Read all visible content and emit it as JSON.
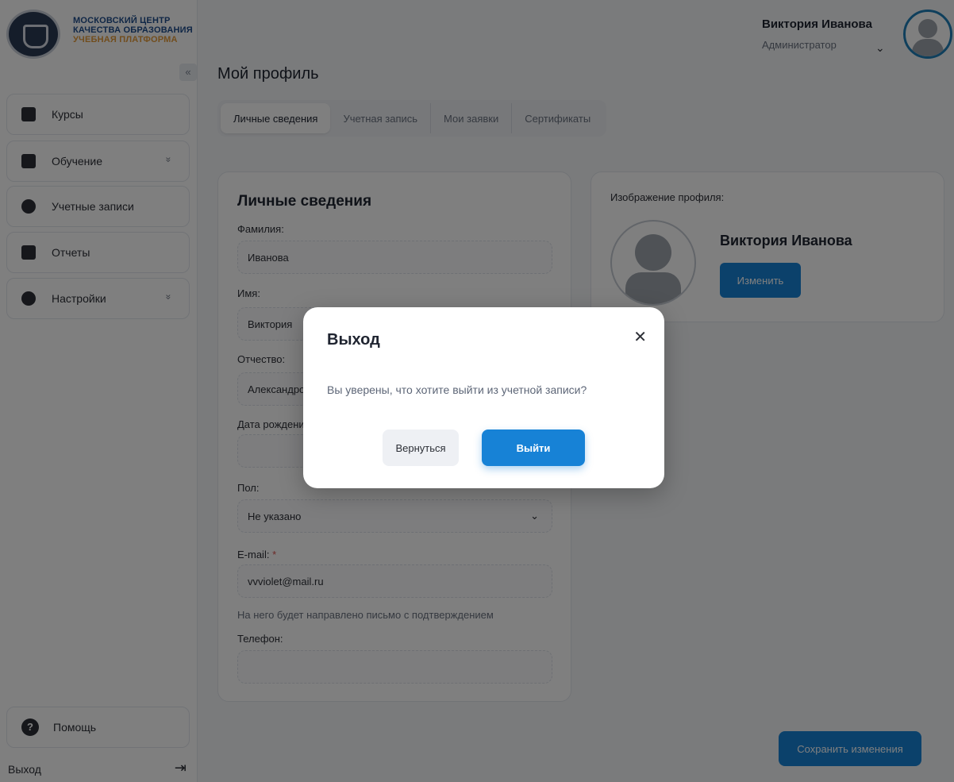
{
  "brand": {
    "line1": "МОСКОВСКИЙ ЦЕНТР",
    "line2": "КАЧЕСТВА ОБРАЗОВАНИЯ",
    "line3": "УЧЕБНАЯ ПЛАТФОРМА",
    "accent": "#1f4d8c",
    "accent2": "#e39a3a"
  },
  "sidebar": {
    "collapse_symbol": "«",
    "items": [
      {
        "label": "Курсы",
        "icon": "edit-icon"
      },
      {
        "label": "Обучение",
        "icon": "graduation-cap-icon",
        "chevron": "»"
      },
      {
        "label": "Учетные записи",
        "icon": "users-icon"
      },
      {
        "label": "Отчеты",
        "icon": "chart-icon"
      },
      {
        "label": "Настройки",
        "icon": "gear-icon",
        "chevron": "»"
      }
    ],
    "help_label": "Помощь",
    "help_symbol": "?",
    "logout_label": "Выход",
    "logout_symbol": "⇥"
  },
  "header": {
    "user_name": "Виктория Иванова",
    "user_role": "Администратор",
    "chevron": "⌄"
  },
  "page": {
    "title": "Мой профиль",
    "tabs": [
      {
        "label": "Личные сведения",
        "active": true
      },
      {
        "label": "Учетная запись"
      },
      {
        "label": "Мои заявки"
      },
      {
        "label": "Сертификаты"
      }
    ]
  },
  "personal": {
    "title": "Личные сведения",
    "last_name_label": "Фамилия:",
    "last_name": "Иванова",
    "first_name_label": "Имя:",
    "first_name": "Виктория",
    "middle_name_label": "Отчество:",
    "middle_name": "Александровна",
    "birth_label": "Дата рождения:",
    "birth": "",
    "gender_label": "Пол:",
    "gender": "Не указано",
    "email_label": "E-mail:",
    "email_required": "*",
    "email": "vvviolet@mail.ru",
    "email_hint": "На него будет направлено письмо с подтверждением",
    "phone_label": "Телефон:",
    "phone": ""
  },
  "profile_image": {
    "label": "Изображение профиля:",
    "name": "Виктория Иванова",
    "change_button": "Изменить"
  },
  "save_button": "Сохранить изменения",
  "modal": {
    "title": "Выход",
    "close_symbol": "✕",
    "message": "Вы уверены, что хотите выйти из учетной записи?",
    "cancel_button": "Вернуться",
    "confirm_button": "Выйти"
  },
  "colors": {
    "primary": "#1782d6",
    "avatar_ring": "#1e7fb8",
    "required": "#d9534f"
  }
}
